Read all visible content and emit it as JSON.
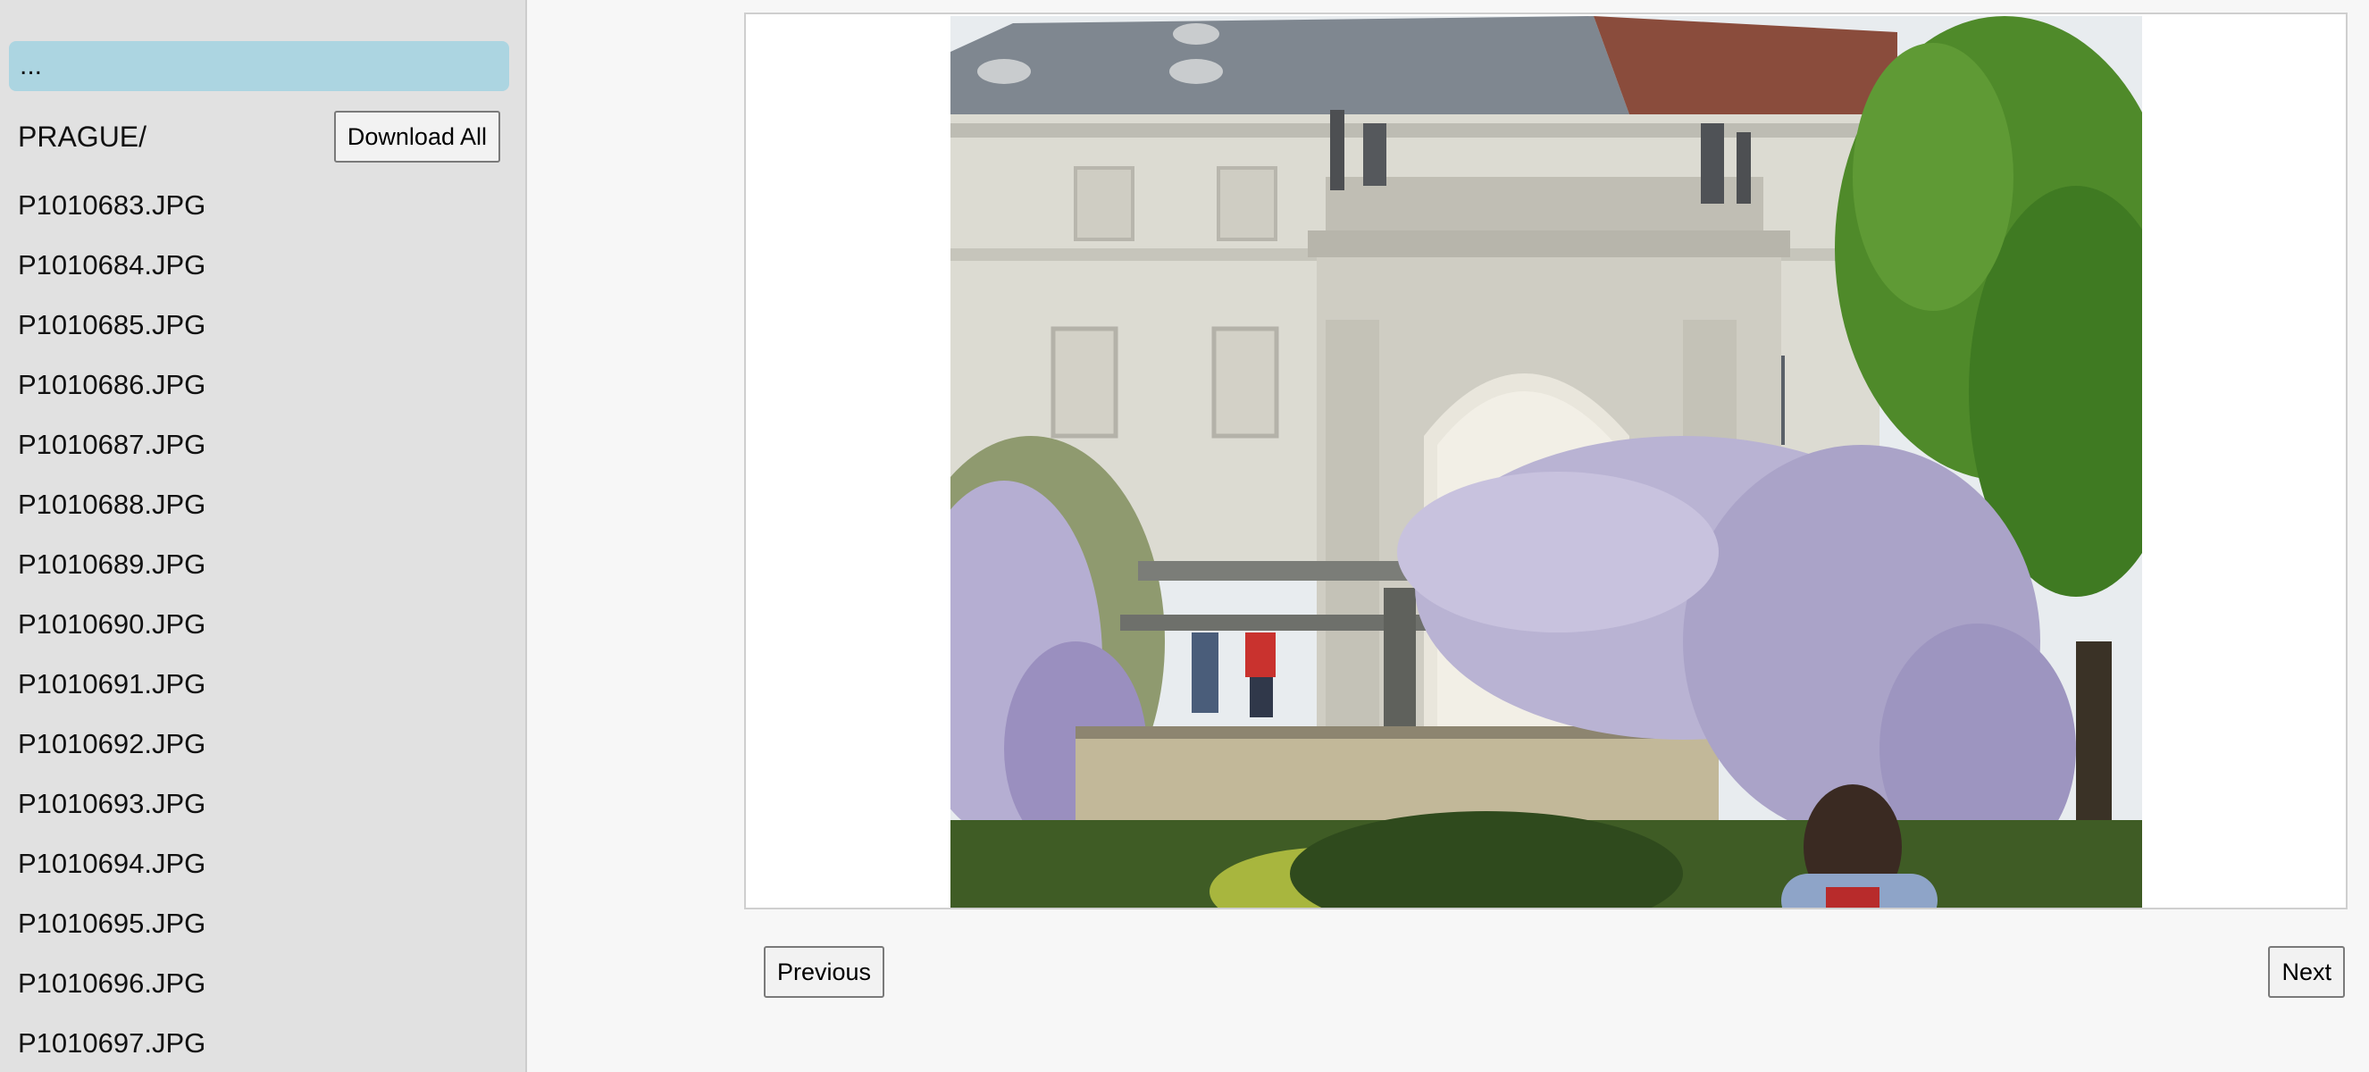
{
  "sidebar": {
    "parent_label": "...",
    "folder_name": "PRAGUE/",
    "download_all_label": "Download All",
    "files": [
      "P1010683.JPG",
      "P1010684.JPG",
      "P1010685.JPG",
      "P1010686.JPG",
      "P1010687.JPG",
      "P1010688.JPG",
      "P1010689.JPG",
      "P1010690.JPG",
      "P1010691.JPG",
      "P1010692.JPG",
      "P1010693.JPG",
      "P1010694.JPG",
      "P1010695.JPG",
      "P1010696.JPG",
      "P1010697.JPG"
    ]
  },
  "viewer": {
    "previous_label": "Previous",
    "next_label": "Next"
  },
  "colors": {
    "sidebar_bg": "#e1e1e1",
    "selected_row": "#acd5e1",
    "page_bg": "#f7f7f7"
  }
}
